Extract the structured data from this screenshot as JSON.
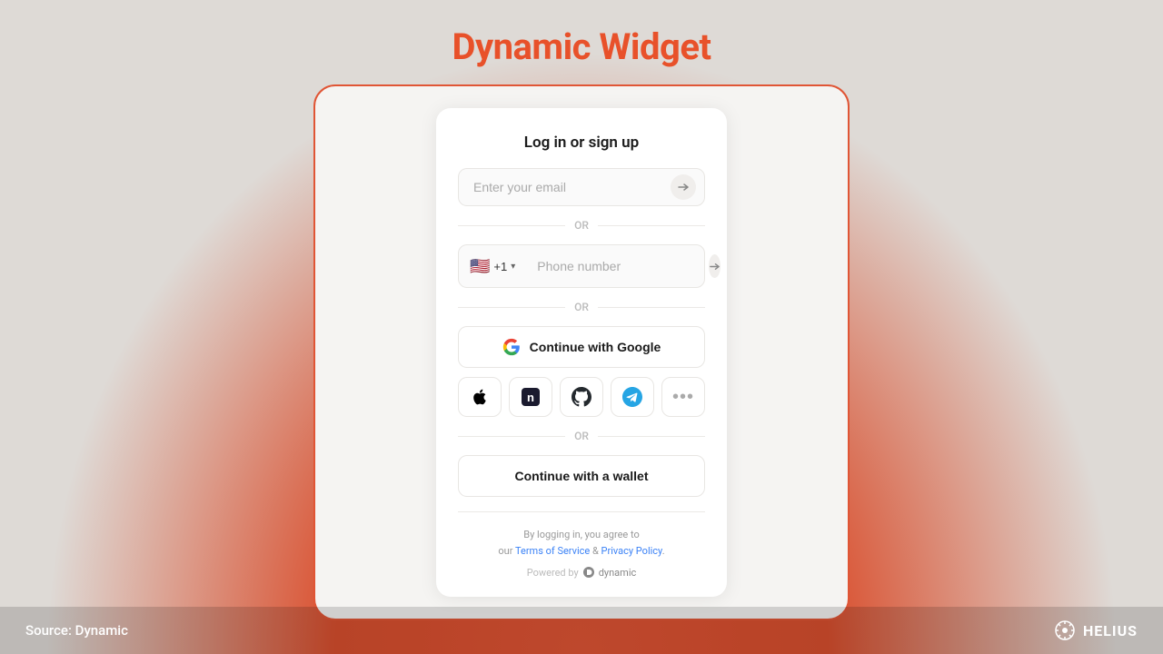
{
  "page": {
    "title": "Dynamic Widget"
  },
  "modal": {
    "heading": "Log in or sign up",
    "email_placeholder": "Enter your email",
    "or_label": "OR",
    "phone_code": "+1",
    "phone_placeholder": "Phone number",
    "google_btn": "Continue with Google",
    "wallet_btn": "Continue with a wallet",
    "footer_text_1": "By logging in, you agree to",
    "footer_text_2": "our",
    "footer_tos": "Terms of Service",
    "footer_amp": "&",
    "footer_privacy": "Privacy Policy",
    "footer_period": ".",
    "powered_label": "Powered by",
    "powered_brand": "dynamic"
  },
  "bottom": {
    "source": "Source: Dynamic",
    "brand": "HELIUS"
  }
}
